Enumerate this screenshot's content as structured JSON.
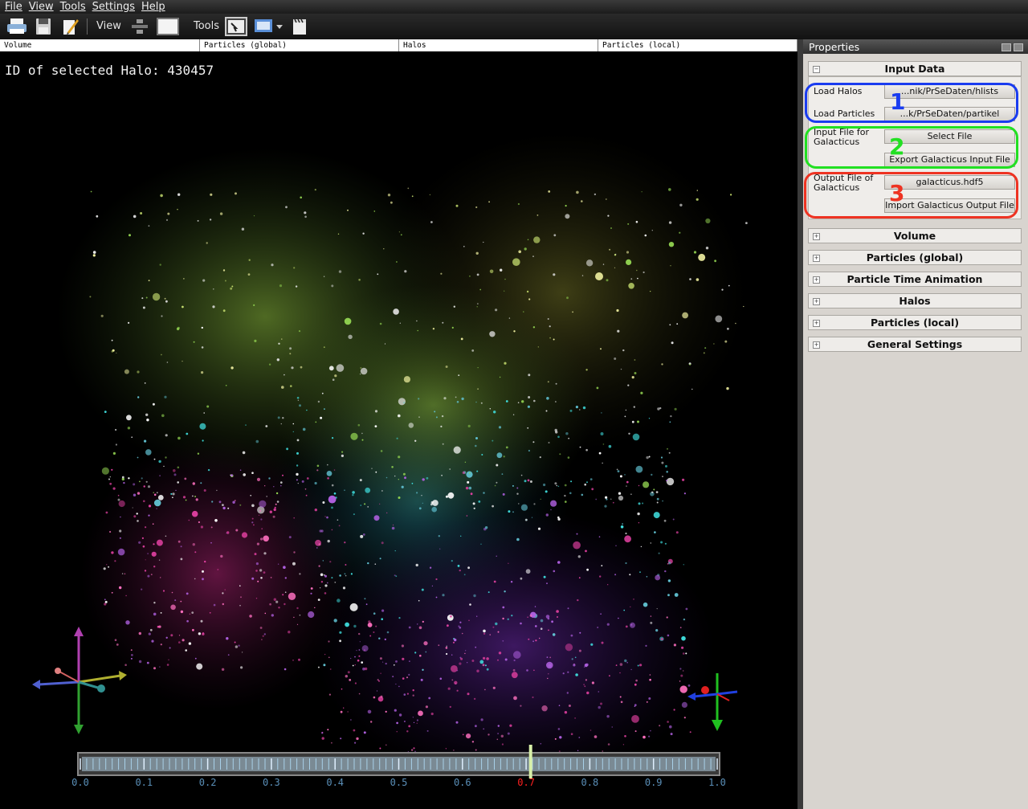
{
  "menu": [
    "File",
    "View",
    "Tools",
    "Settings",
    "Help"
  ],
  "toolbar": {
    "view_label": "View",
    "tools_label": "Tools"
  },
  "view_tabs": [
    "Volume",
    "Particles (global)",
    "Halos",
    "Particles (local)"
  ],
  "viewport": {
    "halo_label": "ID of selected Halo: 430457",
    "timeline": {
      "ticks": [
        "0.0",
        "0.1",
        "0.2",
        "0.3",
        "0.4",
        "0.5",
        "0.6",
        "0.7",
        "0.8",
        "0.9",
        "1.0"
      ],
      "current_label": "0.7",
      "current_value": 0.707
    }
  },
  "panel": {
    "title": "Properties",
    "input_data": {
      "title": "Input Data",
      "load_halos_label": "Load Halos",
      "load_halos_value": "...nik/PrSeDaten/hlists",
      "load_particles_label": "Load Particles",
      "load_particles_value": "...k/PrSeDaten/partikel",
      "input_file_label": "Input File for Galacticus",
      "select_file": "Select File",
      "export_button": "Export Galacticus Input File",
      "output_file_label": "Output File of Galacticus",
      "output_file_value": "galacticus.hdf5",
      "import_button": "Import Galacticus Output File"
    },
    "sections": [
      "Volume",
      "Particles (global)",
      "Particle Time Animation",
      "Halos",
      "Particles (local)",
      "General Settings"
    ],
    "annotations": [
      "1",
      "2",
      "3"
    ]
  },
  "colors": {
    "annotation_1": "#1a3cf0",
    "annotation_2": "#22e022",
    "annotation_3": "#ee3322",
    "timeline_marker": "#d8f0a8",
    "timeline_current_text": "#ff2020",
    "timeline_tick_text": "#5a8fb8"
  }
}
